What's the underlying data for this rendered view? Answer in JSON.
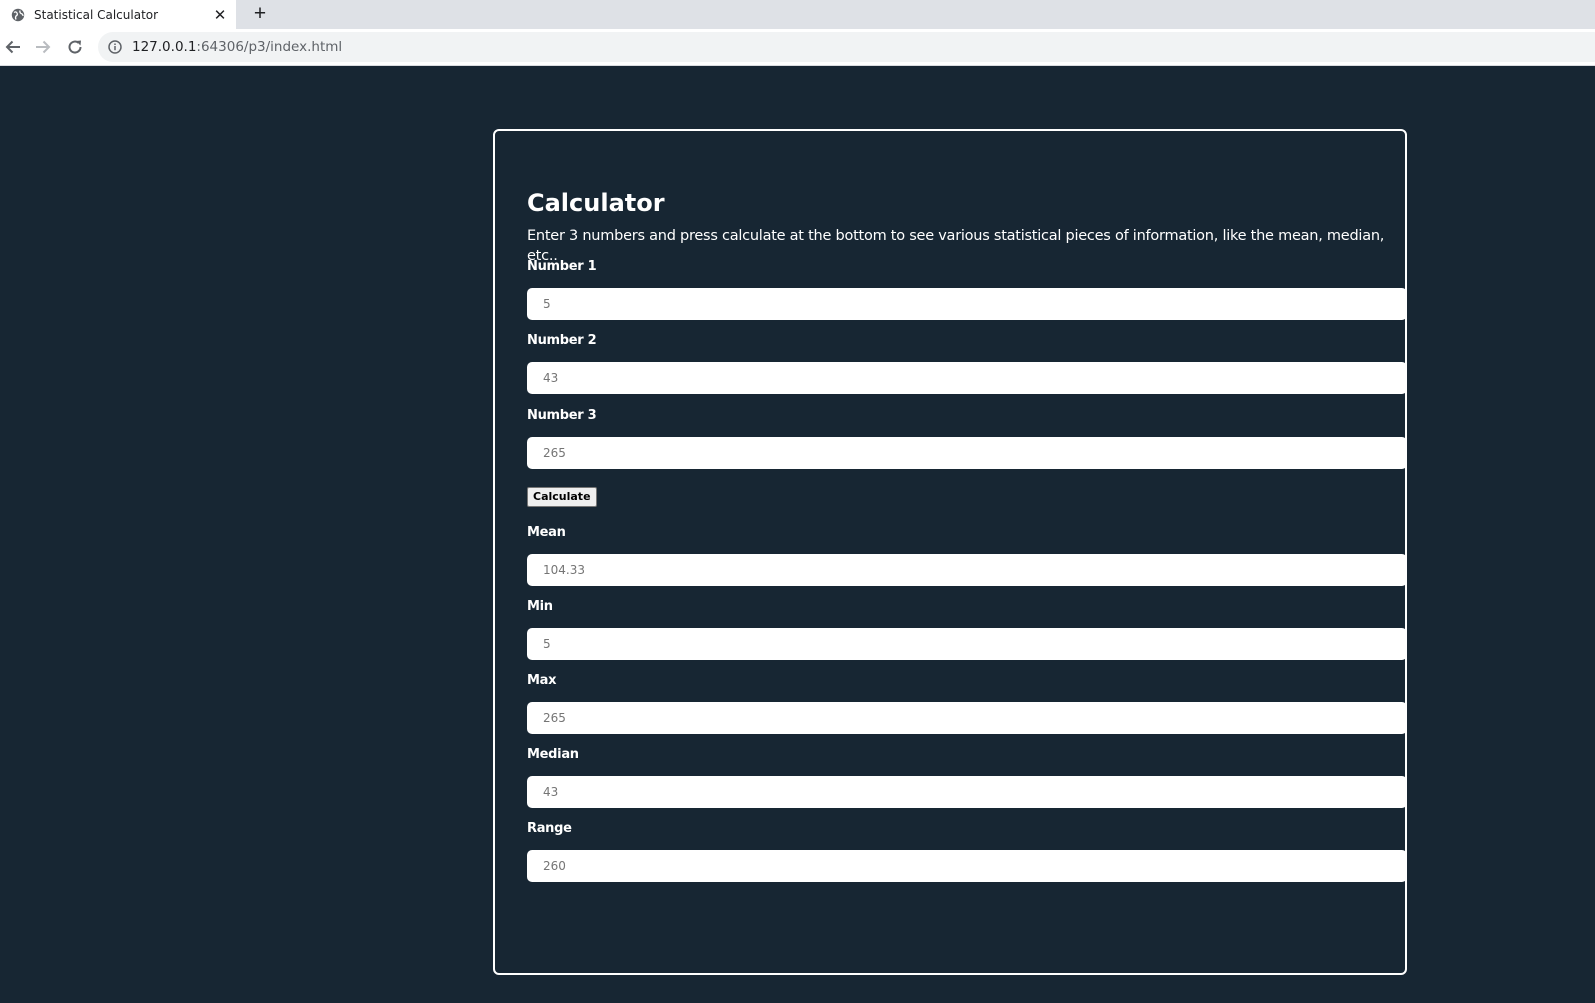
{
  "browser": {
    "tab_title": "Statistical Calculator",
    "tab_close_icon": "close-icon",
    "new_tab_icon": "plus-icon",
    "url_host": "127.0.0.1",
    "url_rest": ":64306/p3/index.html"
  },
  "calculator": {
    "title": "Calculator",
    "description": "Enter 3 numbers and press calculate at the bottom to see various statistical pieces of information, like the mean, median, etc..",
    "number1": {
      "label": "Number 1",
      "placeholder": "5"
    },
    "number2": {
      "label": "Number 2",
      "placeholder": "43"
    },
    "number3": {
      "label": "Number 3",
      "placeholder": "265"
    },
    "calculate_label": "Calculate",
    "mean": {
      "label": "Mean",
      "placeholder": "104.33"
    },
    "min": {
      "label": "Min",
      "placeholder": "5"
    },
    "max": {
      "label": "Max",
      "placeholder": "265"
    },
    "median": {
      "label": "Median",
      "placeholder": "43"
    },
    "range": {
      "label": "Range",
      "placeholder": "260"
    }
  },
  "colors": {
    "page_background": "#172633",
    "card_border": "#ffffff",
    "input_background": "#ffffff",
    "placeholder_text": "#8a8a8a"
  }
}
